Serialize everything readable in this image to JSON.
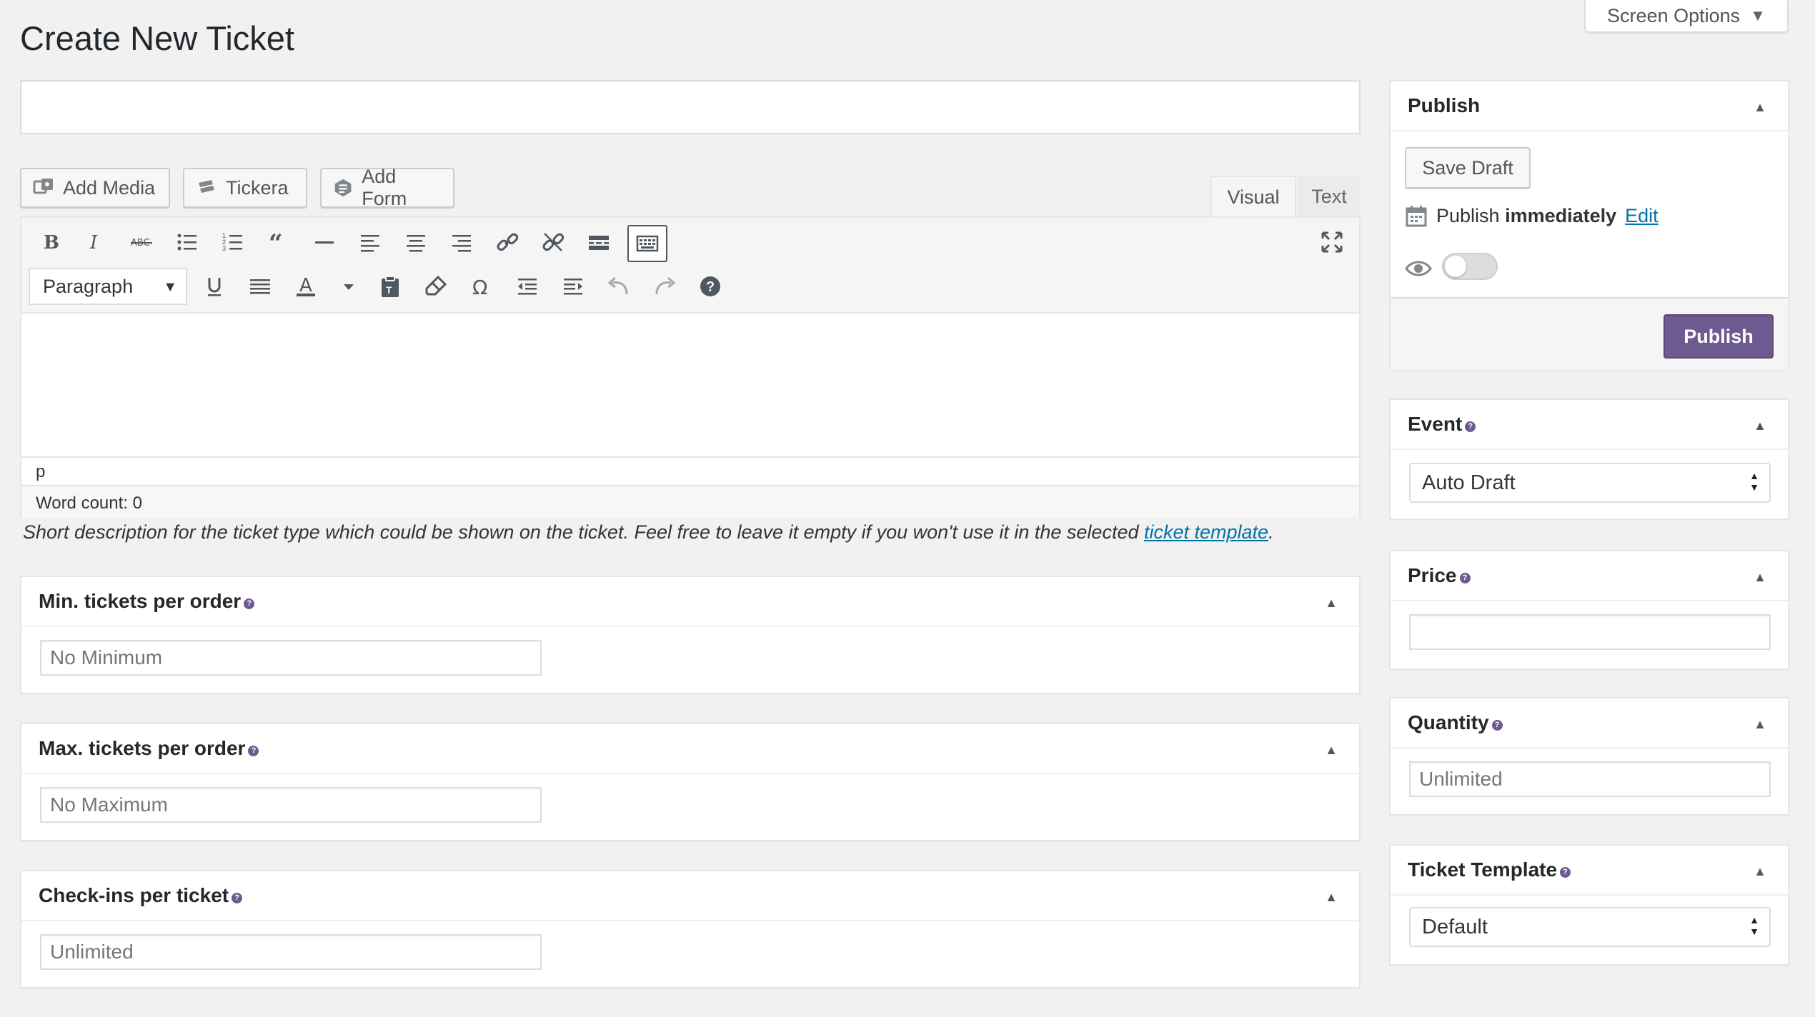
{
  "page": {
    "title": "Create New Ticket",
    "screen_options": "Screen Options"
  },
  "media_buttons": {
    "add_media": "Add Media",
    "tickera": "Tickera",
    "add_form": "Add Form"
  },
  "editor": {
    "tabs": {
      "visual": "Visual",
      "text": "Text"
    },
    "format_select": "Paragraph",
    "path": "p",
    "word_count": "Word count: 0"
  },
  "description": {
    "text": "Short description for the ticket type which could be shown on the ticket. Feel free to leave it empty if you won't use it in the selected ",
    "link": "ticket template",
    "end": "."
  },
  "left_boxes": {
    "min": {
      "title": "Min. tickets per order",
      "placeholder": "No Minimum"
    },
    "max": {
      "title": "Max. tickets per order",
      "placeholder": "No Maximum"
    },
    "checkins": {
      "title": "Check-ins per ticket",
      "placeholder": "Unlimited"
    }
  },
  "publish": {
    "title": "Publish",
    "save_draft": "Save Draft",
    "publish_label": "Publish",
    "publish_when": "immediately",
    "edit_link": "Edit",
    "publish_button": "Publish"
  },
  "event": {
    "title": "Event",
    "selected": "Auto Draft"
  },
  "price": {
    "title": "Price",
    "value": ""
  },
  "quantity": {
    "title": "Quantity",
    "placeholder": "Unlimited"
  },
  "ticket_template": {
    "title": "Ticket Template",
    "selected": "Default"
  },
  "colors": {
    "accent": "#6d5a8f",
    "link": "#0073aa"
  }
}
